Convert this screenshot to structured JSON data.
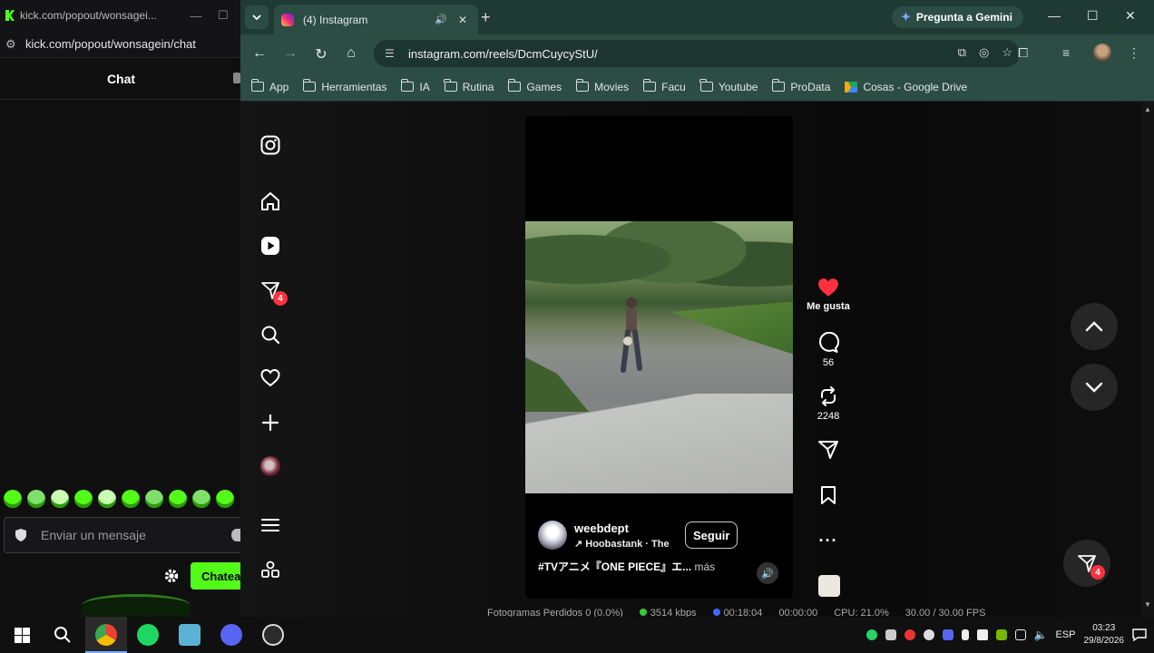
{
  "kick": {
    "tab_title": "kick.com/popout/wonsagei...",
    "url": "kick.com/popout/wonsagein/chat",
    "chat_title": "Chat",
    "message_placeholder": "Enviar un mensaje",
    "send_label": "Chatea"
  },
  "chrome": {
    "tab_title": "(4) Instagram",
    "gemini_label": "Pregunta a Gemini",
    "url": "instagram.com/reels/DcmCuycyStU/",
    "bookmarks": [
      {
        "label": "App",
        "icon": "folder-icon"
      },
      {
        "label": "Herramientas",
        "icon": "folder-icon"
      },
      {
        "label": "IA",
        "icon": "folder-icon"
      },
      {
        "label": "Rutina",
        "icon": "folder-icon"
      },
      {
        "label": "Games",
        "icon": "folder-icon"
      },
      {
        "label": "Movies",
        "icon": "folder-icon"
      },
      {
        "label": "Facu",
        "icon": "folder-icon"
      },
      {
        "label": "Youtube",
        "icon": "folder-icon"
      },
      {
        "label": "ProData",
        "icon": "folder-icon"
      },
      {
        "label": "Cosas - Google Drive",
        "icon": "google-drive-icon"
      }
    ]
  },
  "instagram": {
    "notifications_badge": "4",
    "reel": {
      "username": "weebdept",
      "song": "↗ Hoobastank · The",
      "follow_label": "Seguir",
      "caption": "#TVアニメ『ONE PIECE』エ...",
      "caption_more": " más"
    },
    "actions": {
      "like_label": "Me gusta",
      "comments": "56",
      "reposts": "2248"
    },
    "floating_badge": "4"
  },
  "obs_status": {
    "dropped_frames": "Fotogramas Perdidos 0 (0.0%)",
    "bitrate": "3514 kbps",
    "stream_time": "00:18:04",
    "rec_time": "00:00:00",
    "cpu": "CPU: 21.0%",
    "fps": "30.00 / 30.00 FPS"
  },
  "taskbar": {
    "language": "ESP",
    "time": "03:23",
    "date": "29/8/2026"
  },
  "colors": {
    "kick_green": "#53fc18",
    "chrome_frame": "#2b4d44",
    "like_red": "#ff3040"
  }
}
